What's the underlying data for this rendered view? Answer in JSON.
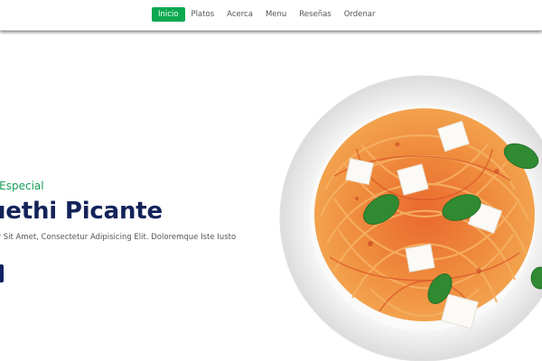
{
  "nav": {
    "items": [
      {
        "label": "Inicio",
        "active": true
      },
      {
        "label": "Platos",
        "active": false
      },
      {
        "label": "Acerca",
        "active": false
      },
      {
        "label": "Menu",
        "active": false
      },
      {
        "label": "Reseñas",
        "active": false
      },
      {
        "label": "Ordenar",
        "active": false
      }
    ]
  },
  "hero": {
    "subtitle": "o Especial",
    "title": "uethi Picante",
    "description": "lor Sit Amet, Consectetur Adipisicing Elit. Doloremque Iste Iusto"
  },
  "colors": {
    "accent_green": "#0aa84f",
    "subtitle_green": "#18a058",
    "title_navy": "#13235a",
    "button_navy": "#0f2364"
  },
  "icons": {
    "hero_image": "spaghetti-plate-image"
  }
}
